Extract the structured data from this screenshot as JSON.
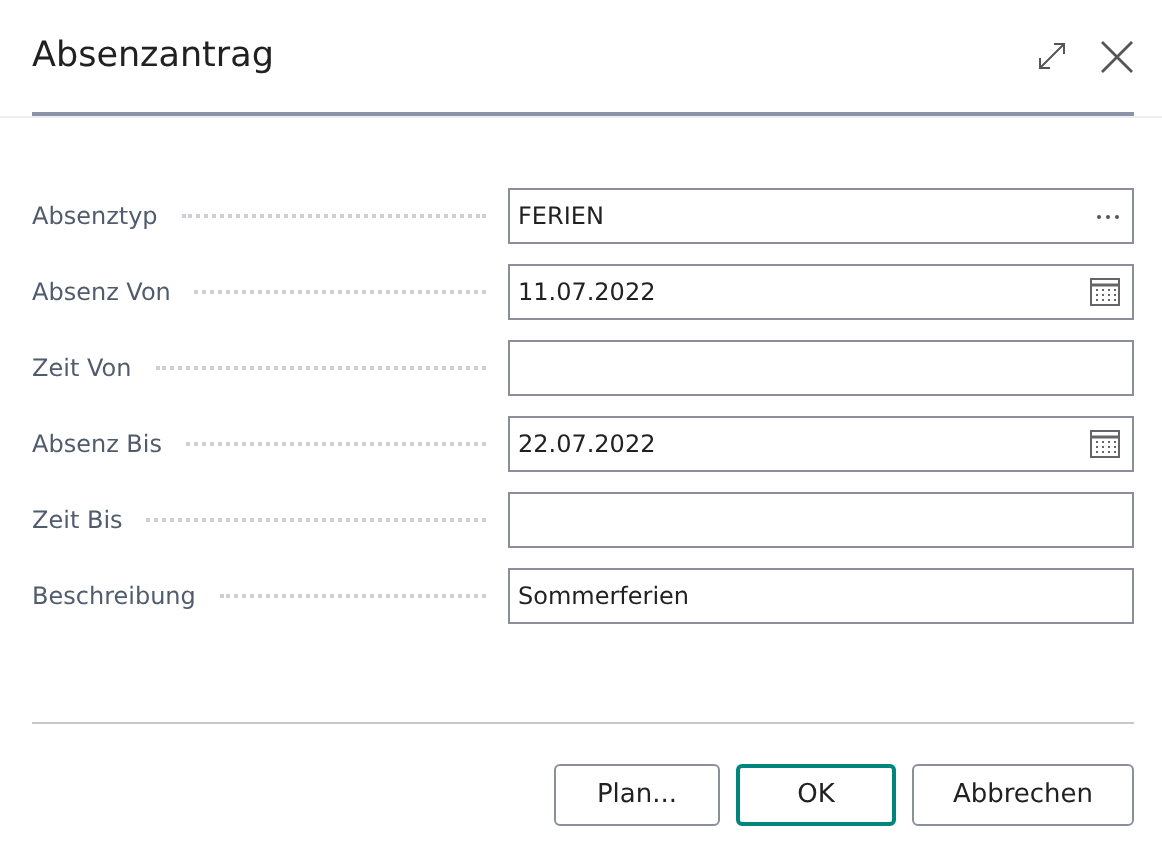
{
  "dialog": {
    "title": "Absenzantrag"
  },
  "fields": [
    {
      "label": "Absenztyp",
      "kind": "lookup",
      "value": "FERIEN"
    },
    {
      "label": "Absenz Von",
      "kind": "date",
      "value": "11.07.2022"
    },
    {
      "label": "Zeit Von",
      "kind": "text"
    },
    {
      "label": "Absenz Bis",
      "kind": "date",
      "value": "22.07.2022"
    },
    {
      "label": "Zeit Bis",
      "kind": "text"
    },
    {
      "label": "Beschreibung",
      "kind": "text",
      "value": "Sommerferien"
    }
  ],
  "buttons": [
    {
      "label": "Plan...",
      "default": false
    },
    {
      "label": "OK",
      "default": true
    },
    {
      "label": "Abbrechen",
      "default": false
    }
  ]
}
